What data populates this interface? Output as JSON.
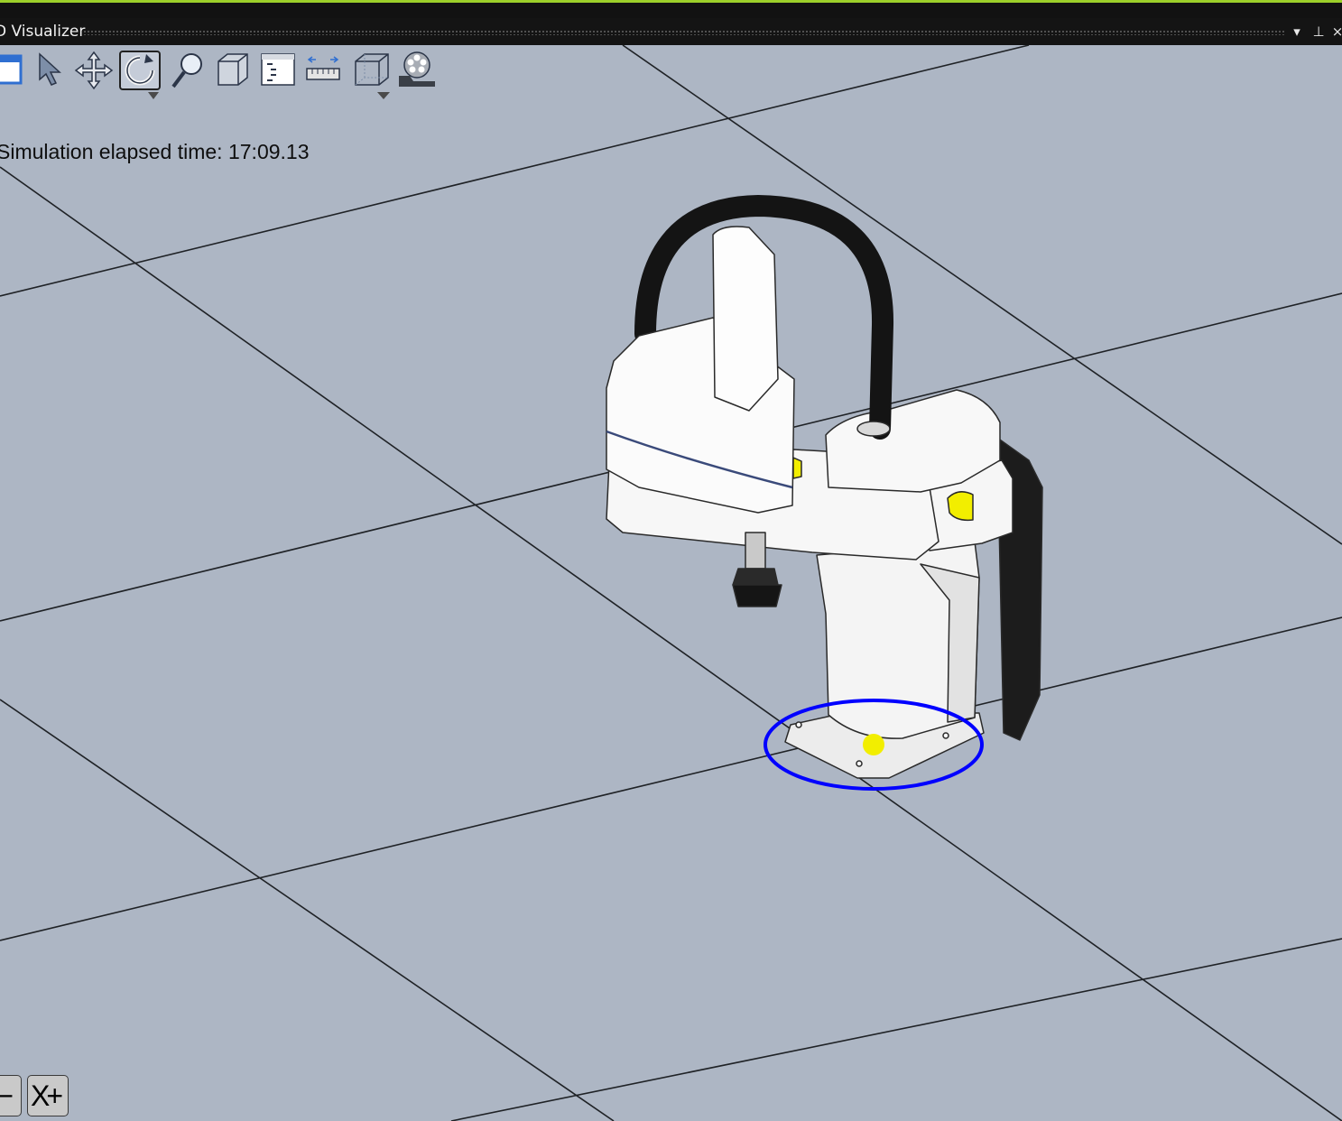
{
  "window": {
    "title": "D Visualizer",
    "dropdown_glyph": "▾",
    "pin_glyph": "⊥",
    "close_glyph": "×"
  },
  "toolbar": {
    "items": [
      {
        "name": "view-panel-icon"
      },
      {
        "name": "select-arrow-icon"
      },
      {
        "name": "pan-move-icon"
      },
      {
        "name": "rotate-orbit-icon",
        "active": true
      },
      {
        "name": "zoom-magnifier-icon"
      },
      {
        "name": "solid-box-icon"
      },
      {
        "name": "properties-list-icon"
      },
      {
        "name": "measure-ruler-icon"
      },
      {
        "name": "wireframe-box-icon"
      },
      {
        "name": "film-camera-icon"
      }
    ]
  },
  "status": {
    "simulation_time": "Simulation elapsed time: 17:09.13"
  },
  "zoom_controls": {
    "minus_label": "X−",
    "plus_label": "X+"
  },
  "scene": {
    "floor_color": "#adb6c4",
    "grid_line_color": "#1f2226",
    "selection_ring_color": "#0000ff",
    "marker_color": "#f2ee00",
    "robot_body_color": "#ffffff",
    "cable_color": "#1a1a1a"
  }
}
